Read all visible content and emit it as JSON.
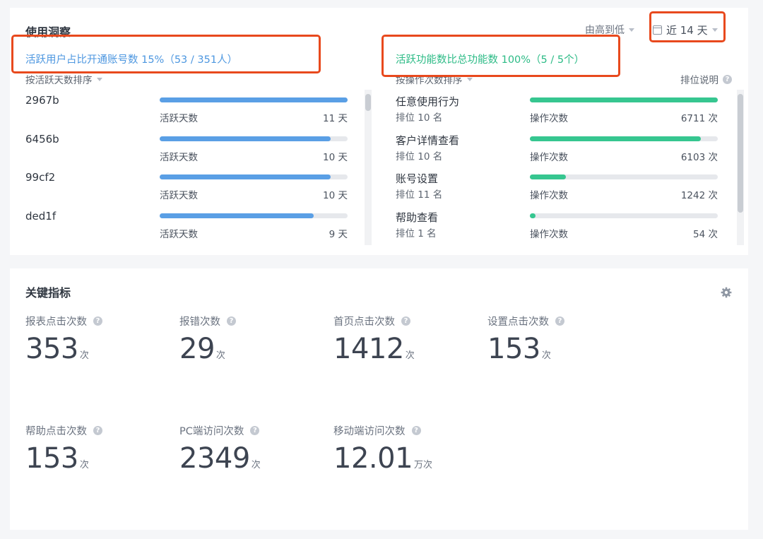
{
  "insight": {
    "title": "使用洞察",
    "sort_order": "由高到低",
    "time_range": "近 14 天",
    "active_users_ratio": "活跃用户占比开通账号数 15%（53 / 351人）",
    "active_features_ratio": "活跃功能数比总功能数 100%（5 / 5个）",
    "users_sort_label": "按活跃天数排序",
    "features_sort_label": "按操作次数排序",
    "ranking_help": "排位说明",
    "users": [
      {
        "name": "2967b",
        "label": "活跃天数",
        "value": "11 天",
        "ratio": 1.0
      },
      {
        "name": "6456b",
        "label": "活跃天数",
        "value": "10 天",
        "ratio": 0.91
      },
      {
        "name": "99cf2",
        "label": "活跃天数",
        "value": "10 天",
        "ratio": 0.91
      },
      {
        "name": "ded1f",
        "label": "活跃天数",
        "value": "9 天",
        "ratio": 0.82
      }
    ],
    "features": [
      {
        "name": "任意使用行为",
        "rank": "排位 10 名",
        "label": "操作次数",
        "value": "6711 次",
        "ratio": 1.0
      },
      {
        "name": "客户详情查看",
        "rank": "排位 10 名",
        "label": "操作次数",
        "value": "6103 次",
        "ratio": 0.91
      },
      {
        "name": "账号设置",
        "rank": "排位 11 名",
        "label": "操作次数",
        "value": "1242 次",
        "ratio": 0.19
      },
      {
        "name": "帮助查看",
        "rank": "排位 1 名",
        "label": "操作次数",
        "value": "54 次",
        "ratio": 0.03
      }
    ]
  },
  "key_metrics": {
    "title": "关键指标",
    "items": [
      {
        "label": "报表点击次数",
        "value": "353",
        "unit": "次"
      },
      {
        "label": "报错次数",
        "value": "29",
        "unit": "次"
      },
      {
        "label": "首页点击次数",
        "value": "1412",
        "unit": "次"
      },
      {
        "label": "设置点击次数",
        "value": "153",
        "unit": "次"
      },
      {
        "label": "帮助点击次数",
        "value": "153",
        "unit": "次"
      },
      {
        "label": "PC端访问次数",
        "value": "2349",
        "unit": "次"
      },
      {
        "label": "移动端访问次数",
        "value": "12.01",
        "unit": "万次"
      }
    ]
  },
  "colors": {
    "highlight_box": "#e8491d",
    "user_bar": "#5a9fe5",
    "feature_bar": "#36c690"
  }
}
